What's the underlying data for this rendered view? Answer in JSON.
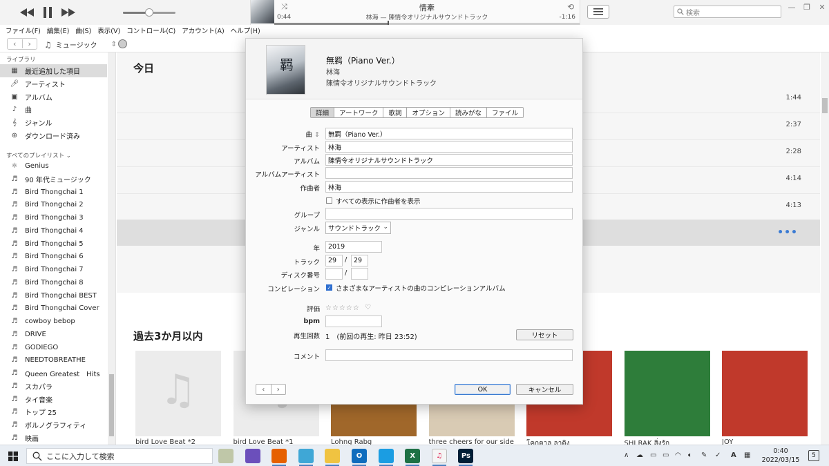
{
  "player": {
    "now_playing_title": "情牽",
    "now_playing_sub": "林海 — 陳情令オリジナルサウンドトラック",
    "elapsed": "0:44",
    "remaining": "-1:16",
    "volume_fraction": 0.5,
    "progress_fraction": 0.37,
    "search_placeholder": "検索"
  },
  "menu": [
    "ファイル(F)",
    "編集(E)",
    "曲(S)",
    "表示(V)",
    "コントロール(C)",
    "アカウント(A)",
    "ヘルプ(H)"
  ],
  "nav": {
    "media": "ミュージック"
  },
  "sidebar": {
    "library_heading": "ライブラリ",
    "library": [
      {
        "label": "最近追加した項目",
        "icon": "grid-icon",
        "selected": true
      },
      {
        "label": "アーティスト",
        "icon": "microphone-icon"
      },
      {
        "label": "アルバム",
        "icon": "album-icon"
      },
      {
        "label": "曲",
        "icon": "note-icon"
      },
      {
        "label": "ジャンル",
        "icon": "genre-icon"
      },
      {
        "label": "ダウンロード済み",
        "icon": "download-icon"
      }
    ],
    "playlists_heading": "すべてのプレイリスト",
    "playlists": [
      {
        "label": "Genius",
        "icon": "genius-icon"
      },
      {
        "label": "90 年代ミュージック",
        "icon": "playlist-icon"
      },
      {
        "label": "Bird Thongchai 1",
        "icon": "playlist-icon"
      },
      {
        "label": "Bird Thongchai 2",
        "icon": "playlist-icon"
      },
      {
        "label": "Bird Thongchai 3",
        "icon": "playlist-icon"
      },
      {
        "label": "Bird Thongchai 4",
        "icon": "playlist-icon"
      },
      {
        "label": "Bird Thongchai 5",
        "icon": "playlist-icon"
      },
      {
        "label": "Bird Thongchai 6",
        "icon": "playlist-icon"
      },
      {
        "label": "Bird Thongchai 7",
        "icon": "playlist-icon"
      },
      {
        "label": "Bird Thongchai 8",
        "icon": "playlist-icon"
      },
      {
        "label": "Bird Thongchai BEST",
        "icon": "playlist-icon"
      },
      {
        "label": "Bird Thongchai Cover",
        "icon": "playlist-icon"
      },
      {
        "label": "cowboy bebop",
        "icon": "playlist-icon"
      },
      {
        "label": "DRIVE",
        "icon": "playlist-icon"
      },
      {
        "label": "GODIEGO",
        "icon": "playlist-icon"
      },
      {
        "label": "NEEDTOBREATHE",
        "icon": "playlist-icon"
      },
      {
        "label": "Queen Greatest　Hits",
        "icon": "playlist-icon"
      },
      {
        "label": "スカパラ",
        "icon": "playlist-icon"
      },
      {
        "label": "タイ音楽",
        "icon": "playlist-icon"
      },
      {
        "label": "トップ 25",
        "icon": "playlist-icon"
      },
      {
        "label": "ポルノグラフィティ",
        "icon": "playlist-icon"
      },
      {
        "label": "映画",
        "icon": "playlist-icon"
      }
    ]
  },
  "main": {
    "today_title": "今日",
    "durations": [
      "1:44",
      "2:37",
      "2:28",
      "4:14",
      "4:13"
    ],
    "more_icon": "•••",
    "section_title": "過去3か月以内",
    "albums": [
      {
        "caption": "bird Love Beat *2",
        "color": "#ececec"
      },
      {
        "caption": "bird Love Beat *1",
        "color": "#ececec"
      },
      {
        "caption": "Lohng Rabg",
        "color": "#a0672a"
      },
      {
        "caption": "three cheers for our side",
        "color": "#d9cbb4"
      },
      {
        "caption": "โคกตาล ลาติง",
        "color": "#c0392b"
      },
      {
        "caption": "SHI RAK สิ่งรัก",
        "color": "#2e7d3a"
      },
      {
        "caption": "JOY",
        "color": "#c0392b"
      }
    ]
  },
  "dialog": {
    "title": "無羁（Piano Ver.）",
    "artist": "林海",
    "album": "陳情令オリジナルサウンドトラック",
    "tabs": [
      "詳細",
      "アートワーク",
      "歌詞",
      "オプション",
      "読みがな",
      "ファイル"
    ],
    "active_tab": 0,
    "labels": {
      "song": "曲",
      "artist": "アーティスト",
      "album": "アルバム",
      "album_artist": "アルバムアーティスト",
      "composer": "作曲者",
      "group": "グループ",
      "genre": "ジャンル",
      "year": "年",
      "track": "トラック",
      "disc": "ディスク番号",
      "compilation": "コンピレーション",
      "rating": "評価",
      "bpm": "bpm",
      "plays": "再生回数",
      "comment": "コメント"
    },
    "values": {
      "song": "無羁（Piano Ver.）",
      "artist": "林海",
      "album": "陳情令オリジナルサウンドトラック",
      "album_artist": "",
      "composer": "林海",
      "show_composer_label": "すべての表示に作曲者を表示",
      "show_composer_checked": false,
      "group": "",
      "genre": "サウンドトラック",
      "year": "2019",
      "track_number": "29",
      "track_total": "29",
      "disc_number": "",
      "disc_total": "",
      "compilation_label": "さまざまなアーティストの曲のコンピレーションアルバム",
      "compilation_checked": true,
      "rating_stars": 0,
      "rating_max": 5,
      "bpm": "",
      "plays": "1　(前回の再生: 昨日 23:52)",
      "comment": ""
    },
    "buttons": {
      "reset": "リセット",
      "ok": "OK",
      "cancel": "キャンセル"
    }
  },
  "taskbar": {
    "search_placeholder": "ここに入力して検索",
    "apps": [
      {
        "name": "notepad-app",
        "color": "#bfc7a8",
        "label": ""
      },
      {
        "name": "itunes-purple-app",
        "color": "#6b4fbb",
        "label": ""
      },
      {
        "name": "firefox-app",
        "color": "#e66000",
        "label": ""
      },
      {
        "name": "photos-app",
        "color": "#3fa7d6",
        "label": ""
      },
      {
        "name": "explorer-app",
        "color": "#f0c341",
        "label": ""
      },
      {
        "name": "outlook-app",
        "color": "#0f6cbd",
        "label": "O"
      },
      {
        "name": "edge-app",
        "color": "#1b9de2",
        "label": ""
      },
      {
        "name": "excel-app",
        "color": "#1e7145",
        "label": "X"
      },
      {
        "name": "itunes-app",
        "color": "#f5f5f5",
        "label": ""
      },
      {
        "name": "photoshop-app",
        "color": "#001e36",
        "label": "Ps"
      }
    ],
    "tray_input": "A",
    "time": "0:40",
    "date": "2022/03/15",
    "notifications": "5"
  }
}
